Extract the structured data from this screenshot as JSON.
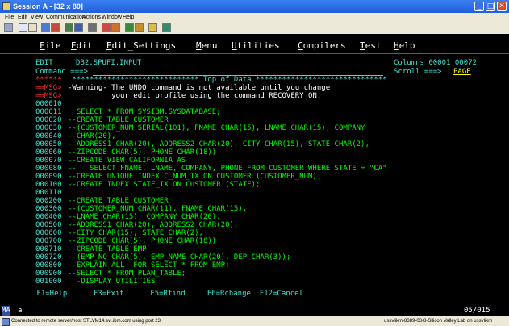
{
  "window": {
    "title": "Session A - [32 x 80]",
    "controls": {
      "minimize": "_",
      "maximize": "□",
      "close": "✕"
    }
  },
  "menubar": [
    "File",
    "Edit",
    "View",
    "Communication",
    "Actions",
    "Window",
    "Help"
  ],
  "toolbar": {
    "icons": [
      "print-icon",
      "copy-icon",
      "paste-icon",
      "send-icon",
      "receive-icon",
      "display-icon",
      "color-icon",
      "map-icon",
      "record-icon",
      "stop-icon",
      "play-icon",
      "macro-icon",
      "support-icon",
      "index-icon"
    ]
  },
  "ispf": {
    "menu": [
      "File",
      "Edit",
      "Edit_Settings",
      "Menu",
      "Utilities",
      "Compilers",
      "Test",
      "Help"
    ],
    "edit_label": "EDIT",
    "dataset": "DB2.SPUFI.INPUT",
    "columns_label": "Columns 00001 00072",
    "command_label": "Command ===>",
    "scroll_label": "Scroll ===>",
    "scroll_value": "PAGE",
    "msg1_prefix": "==MSG>",
    "msg1_text": "-Warning- The UNDO command is not available until you change",
    "msg2_prefix": "==MSG>",
    "msg2_text": "          your edit profile using the command RECOVERY ON.",
    "top_stars": "******",
    "top_of_data": " ***************************** Top of Data ******************************",
    "lines": [
      {
        "num": "000010",
        "text": ""
      },
      {
        "num": "000011",
        "text": "  SELECT * FROM SYSIBM.SYSDATABASE;"
      },
      {
        "num": "000020",
        "text": "--CREATE TABLE CUSTOMER"
      },
      {
        "num": "000030",
        "text": "--(CUSTOMER_NUM SERIAL(101), FNAME CHAR(15), LNAME CHAR(15), COMPANY"
      },
      {
        "num": "000040",
        "text": "--CHAR(20),"
      },
      {
        "num": "000050",
        "text": "--ADDRESS1 CHAR(20), ADDRESS2 CHAR(20), CITY CHAR(15), STATE CHAR(2),"
      },
      {
        "num": "000060",
        "text": "--ZIPCODE CHAR(5), PHONE CHAR(18))"
      },
      {
        "num": "000070",
        "text": "--CREATE VIEW CALIFORNIA AS"
      },
      {
        "num": "000080",
        "text": "--   SELECT FNAME, LNAME, COMPANY, PHONE FROM CUSTOMER WHERE STATE = \"CA\""
      },
      {
        "num": "000090",
        "text": "--CREATE UNIQUE INDEX C_NUM_IX ON CUSTOMER (CUSTOMER_NUM);"
      },
      {
        "num": "000100",
        "text": "--CREATE INDEX STATE_IX ON CUSTOMER (STATE);"
      },
      {
        "num": "000110",
        "text": ""
      },
      {
        "num": "000200",
        "text": "--CREATE TABLE CUSTOMER"
      },
      {
        "num": "000300",
        "text": "--(CUSTOMER_NUM CHAR(11), FNAME CHAR(15),"
      },
      {
        "num": "000400",
        "text": "--LNAME CHAR(15), COMPANY CHAR(20),"
      },
      {
        "num": "000500",
        "text": "--ADDRESS1 CHAR(20), ADDRESS2 CHAR(20),"
      },
      {
        "num": "000600",
        "text": "--CITY CHAR(15), STATE CHAR(2),"
      },
      {
        "num": "000700",
        "text": "--ZIPCODE CHAR(5), PHONE CHAR(18))"
      },
      {
        "num": "000710",
        "text": "--CREATE TABLE EMP"
      },
      {
        "num": "000720",
        "text": "--(EMP_NO CHAR(5), EMP_NAME CHAR(20), DEP CHAR(3));"
      },
      {
        "num": "000800",
        "text": "--EXPLAIN ALL  FOR SELECT * FROM EMP;"
      },
      {
        "num": "000900",
        "text": "--SELECT * FROM PLAN_TABLE;"
      },
      {
        "num": "001000",
        "text": "  -DISPLAY UTILITIES"
      }
    ],
    "fkeys": " F1=Help      F3=Exit      F5=Rfind     F6=Rchange  F12=Cancel"
  },
  "oia": {
    "indicator": "MA",
    "session": "a",
    "cursor": "05/015"
  },
  "statusbar": {
    "left": "Connected to remote server/host STLVM14.svl.ibm.com using port 23",
    "right": "ussvlikm-8389-03-8-Silicon Valley Lab on ussvlikm"
  },
  "colors": {
    "titlebar": "#2a6ae6",
    "terminal_bg": "#000000",
    "green": "#00ff00",
    "turquoise": "#40e0d0",
    "red": "#ff3030",
    "white": "#ffffff",
    "yellow": "#ffff00"
  }
}
